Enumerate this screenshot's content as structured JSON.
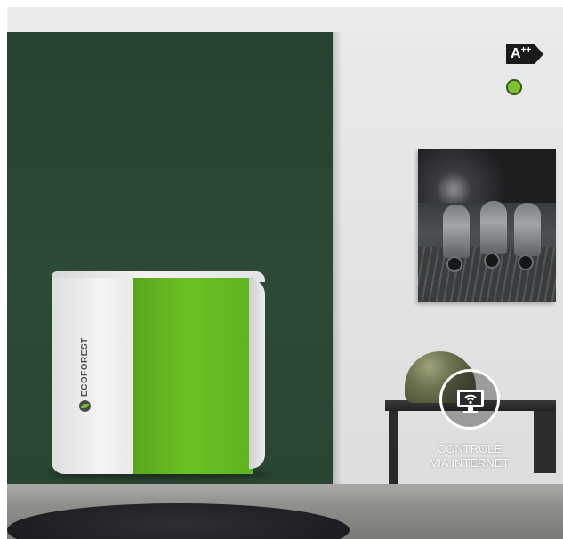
{
  "energy_rating": {
    "grade": "A",
    "plus": "++",
    "color": "#1a1a1a"
  },
  "hotspot": {
    "color": "#7fc130"
  },
  "product": {
    "brand_name": "ECOFOREST",
    "panel_color": "#6cc024"
  },
  "feature": {
    "line1": "CONTRÔLE",
    "line2": "VIA INTERNET",
    "icon": "wifi-monitor-icon"
  }
}
